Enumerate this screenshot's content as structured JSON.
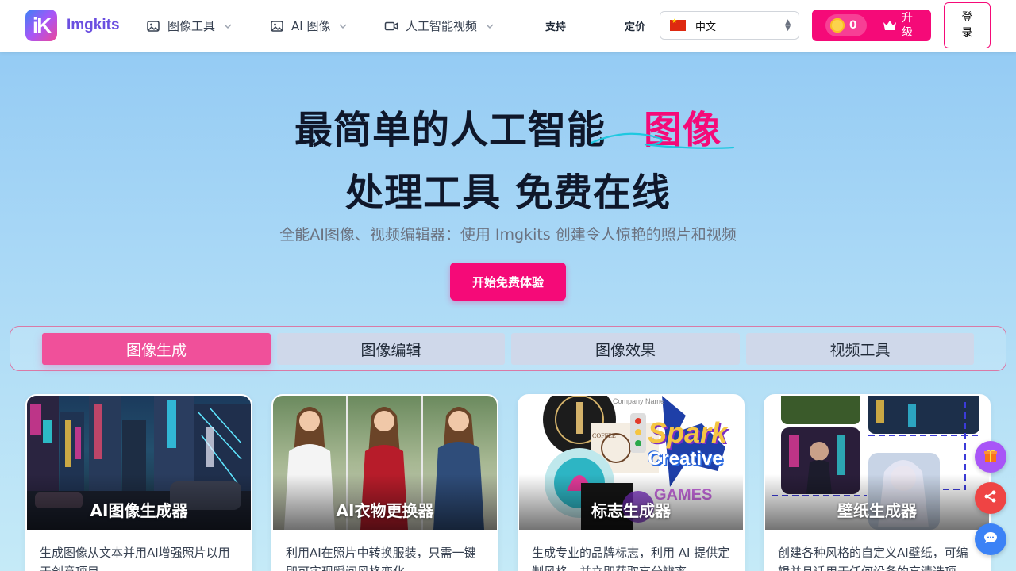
{
  "brand": {
    "name": "Imgkits",
    "logo_letters": "iK"
  },
  "nav": {
    "menus": [
      {
        "label": "图像工具",
        "icon": "image-icon"
      },
      {
        "label": "AI 图像",
        "icon": "image-icon"
      },
      {
        "label": "人工智能视频",
        "icon": "video-icon"
      }
    ],
    "support": "支持",
    "pricing": "定价",
    "language": "中文",
    "coins": "0",
    "upgrade": "升级",
    "login": "登录"
  },
  "hero": {
    "line1": "最简单的人工智能",
    "highlight": "图像",
    "line2": "处理工具 免费在线",
    "subtitle": "全能AI图像、视频编辑器：使用 Imgkits 创建令人惊艳的照片和视频",
    "cta": "开始免费体验"
  },
  "tabs": [
    {
      "label": "图像生成",
      "active": true
    },
    {
      "label": "图像编辑",
      "active": false
    },
    {
      "label": "图像效果",
      "active": false
    },
    {
      "label": "视频工具",
      "active": false
    }
  ],
  "cards": [
    {
      "title": "AI图像生成器",
      "desc": "生成图像从文本并用AI增强照片以用于创意项目。"
    },
    {
      "title": "AI衣物更换器",
      "desc": "利用AI在照片中转换服装，只需一键即可实现瞬间风格变化。"
    },
    {
      "title": "标志生成器",
      "desc": "生成专业的品牌标志，利用 AI 提供定制风格，并立即获取高分辨率。"
    },
    {
      "title": "壁纸生成器",
      "desc": "创建各种风格的自定义AI壁纸，可编辑并且适用于任何设备的高清选项。"
    }
  ],
  "logo_card_text": {
    "company": "Company Name",
    "spark": "Spark",
    "creative": "Creative",
    "games": "GAMES",
    "coffee": "COFFEE"
  },
  "colors": {
    "accent": "#f50a78",
    "tab_active": "#f0509a",
    "tab_inactive": "#cfd8ea"
  },
  "fabs": [
    {
      "icon": "gift-icon",
      "color": "#a855f7"
    },
    {
      "icon": "share-icon",
      "color": "#ef4444"
    },
    {
      "icon": "chat-icon",
      "color": "#3b82f6"
    }
  ]
}
